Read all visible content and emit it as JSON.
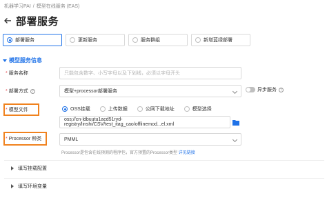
{
  "breadcrumb": {
    "root": "机器学习PAI",
    "separator": "/",
    "current": "模型在线服务 (EAS)"
  },
  "page": {
    "title": "部署服务"
  },
  "modes": [
    {
      "label": "部署服务",
      "selected": true
    },
    {
      "label": "更新服务",
      "selected": false
    },
    {
      "label": "服务群组",
      "selected": false
    },
    {
      "label": "新增蓝绿部署",
      "selected": false
    }
  ],
  "section": {
    "title": "模型服务信息"
  },
  "form": {
    "service_name": {
      "label": "服务名称",
      "placeholder": "只能包含数字、小写字母以及下划线，必须以字母开头"
    },
    "deploy_method": {
      "label": "部署方式",
      "value": "模型+processor部署服务"
    },
    "async": {
      "label": "异步服务"
    },
    "model_file": {
      "label": "模型文件",
      "options": [
        "OSS挂载",
        "上传数据",
        "公网下载地址",
        "模型选择"
      ],
      "selected_index": 0,
      "path": "oss://cn-ldbuutu1acd51ryd-registry/linshi/CSV/test_itag_cao/offlinemod...el.xml"
    },
    "processor": {
      "label": "Processor 种类",
      "value": "PMML",
      "hint": "Processor是包含在线预测的程序包，官方预置的Processor类型",
      "hint_link": "详见链接"
    }
  },
  "collapsibles": [
    {
      "label": "填写挂载配置"
    },
    {
      "label": "填写环境变量"
    }
  ],
  "colors": {
    "accent": "#1f72e8",
    "highlight": "#f0821e",
    "required": "#e5484d"
  }
}
